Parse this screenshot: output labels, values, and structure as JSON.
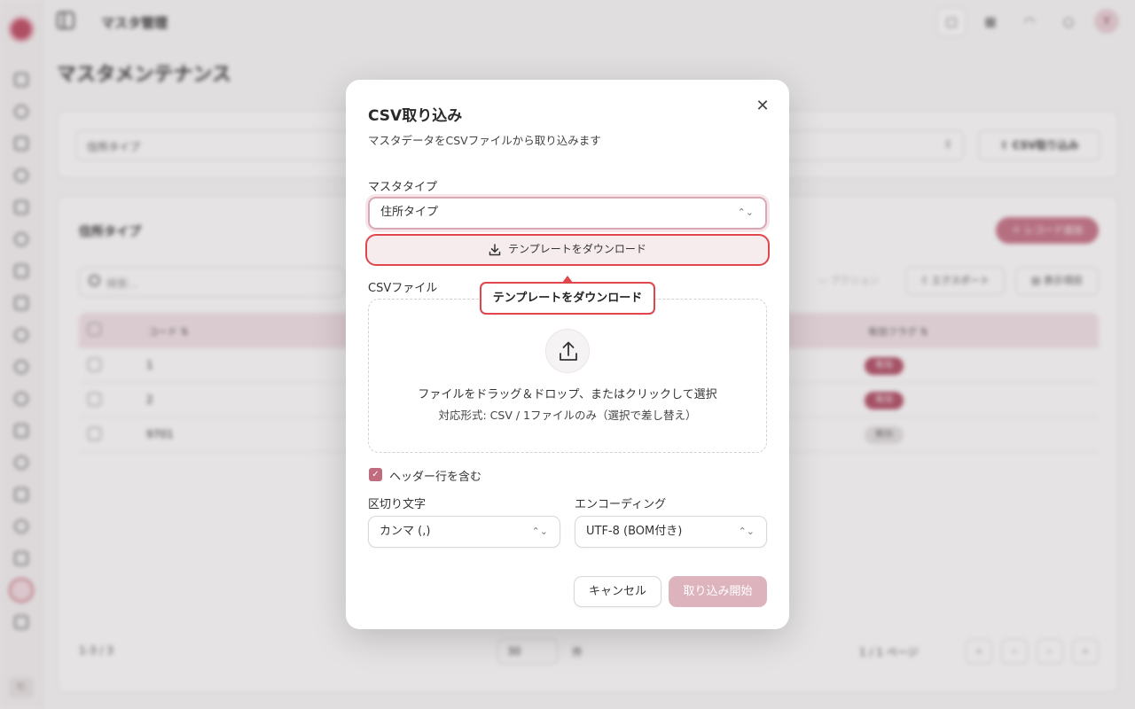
{
  "app": {
    "header_title": "マスタ管理",
    "user_initials": "Y",
    "rail_user_label": "ﾏﾆ"
  },
  "page": {
    "title": "マスタメンテナンス",
    "master_select_value": "住所タイプ",
    "csv_import_button": "CSV取り込み",
    "section_title": "住所タイプ",
    "add_record_button": "＋ レコード追加",
    "search_placeholder": "検索...",
    "toolbar": {
      "action": "— アクション",
      "export": "エクスポート",
      "display": "表示項目"
    },
    "table": {
      "columns": [
        "コード ⇅",
        "有効フラグ ⇅"
      ],
      "rows": [
        {
          "code": "1",
          "flag": "有効",
          "active": true
        },
        {
          "code": "2",
          "flag": "有効",
          "active": true
        },
        {
          "code": "9701",
          "flag": "無効",
          "active": false
        }
      ]
    },
    "pager": {
      "count": "1-3 / 3",
      "page_size": "30",
      "unit": "件",
      "page_info": "1 / 1 ページ"
    }
  },
  "dialog": {
    "title": "CSV取り込み",
    "description": "マスタデータをCSVファイルから取り込みます",
    "master_type_label": "マスタタイプ",
    "master_type_value": "住所タイプ",
    "template_button": "テンプレートをダウンロード",
    "tooltip": "テンプレートをダウンロード",
    "csv_file_label": "CSVファイル",
    "dropzone_main": "ファイルをドラッグ＆ドロップ、またはクリックして選択",
    "dropzone_sub": "対応形式: CSV / 1ファイルのみ（選択で差し替え）",
    "header_checkbox_label": "ヘッダー行を含む",
    "header_checked": true,
    "delimiter_label": "区切り文字",
    "delimiter_value": "カンマ (,)",
    "encoding_label": "エンコーディング",
    "encoding_value": "UTF-8 (BOM付き)",
    "cancel_button": "キャンセル",
    "start_button": "取り込み開始"
  },
  "colors": {
    "accent": "#c06b7e",
    "highlight": "#e0464c",
    "disabled_primary": "#ddb4be"
  }
}
